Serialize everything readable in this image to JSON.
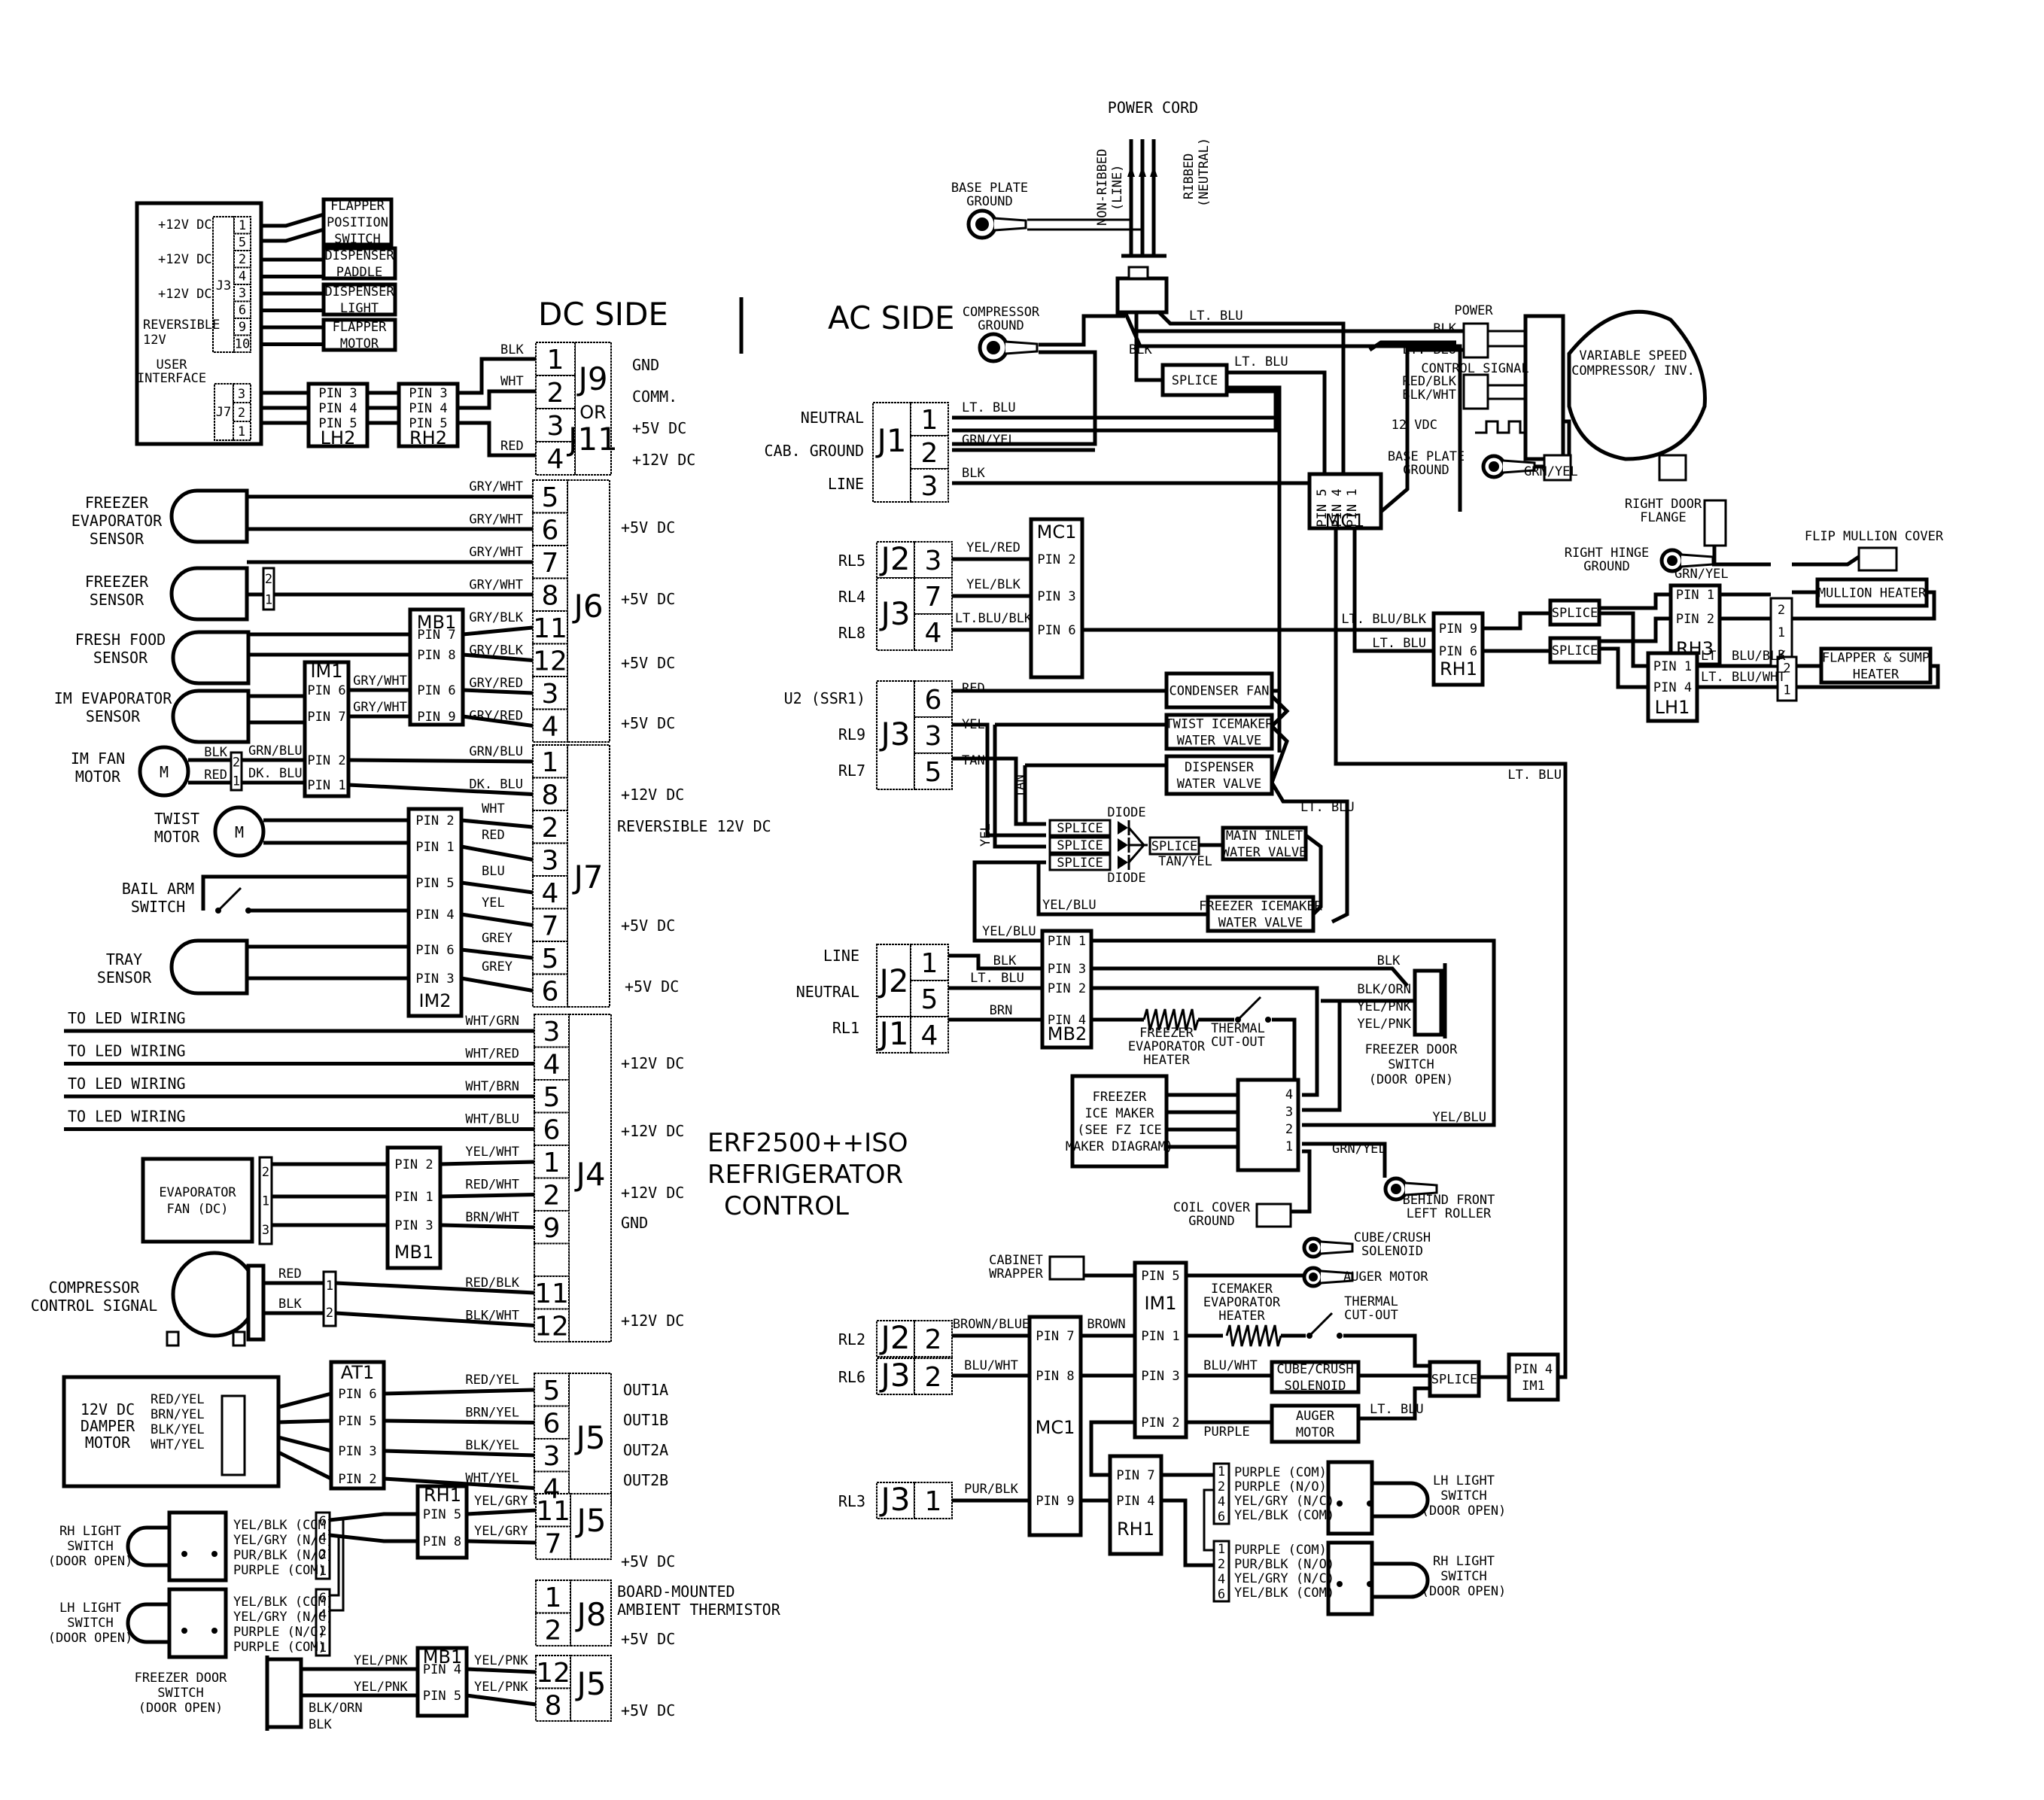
{
  "title": {
    "line1": "ERF2500++ISO",
    "line2": "REFRIGERATOR",
    "line3": "CONTROL"
  },
  "sections": {
    "dc": "DC SIDE",
    "ac": "AC SIDE"
  },
  "power_cord": {
    "title": "POWER CORD",
    "line": "NON-RIBBED",
    "line_sub": "(LINE)",
    "neutral": "RIBBED",
    "neutral_sub": "(NEUTRAL)"
  },
  "grounds": {
    "base_plate_top": [
      "BASE PLATE",
      "GROUND"
    ],
    "compressor": [
      "COMPRESSOR",
      "GROUND"
    ],
    "base_plate_right": [
      "BASE PLATE",
      "GROUND"
    ],
    "right_hinge": [
      "RIGHT HINGE",
      "GROUND"
    ],
    "right_door_flange": [
      "RIGHT DOOR",
      "FLANGE"
    ],
    "flip_mullion": "FLIP MULLION COVER",
    "coil_cover": [
      "COIL COVER",
      "GROUND"
    ],
    "behind_roller": [
      "BEHIND FRONT",
      "LEFT ROLLER"
    ],
    "cabinet_wrapper": [
      "CABINET",
      "WRAPPER"
    ]
  },
  "compressor_inv": {
    "label": [
      "VARIABLE SPEED",
      "COMPRESSOR/ INV."
    ],
    "power": "POWER",
    "control": "CONTROL SIGNAL",
    "vdc": "12 VDC"
  },
  "user_interface": {
    "label": [
      "USER",
      "INTERFACE"
    ],
    "j3": "J3",
    "j7": "J7",
    "j3_pins": [
      "1",
      "5",
      "2",
      "4",
      "3",
      "6",
      "9",
      "10"
    ],
    "j7_pins": [
      "3",
      "2",
      "1"
    ],
    "side_labels": [
      "+12V DC",
      "+12V DC",
      "+12V DC",
      "REVERSIBLE",
      "12V"
    ],
    "devices": [
      [
        "FLAPPER",
        "POSITION",
        "SWITCH"
      ],
      [
        "DISPENSER",
        "PADDLE"
      ],
      [
        "DISPENSER",
        "LIGHT"
      ],
      [
        "FLAPPER",
        "MOTOR"
      ]
    ],
    "lh2": {
      "name": "LH2",
      "pins": [
        "PIN 3",
        "PIN 4",
        "PIN 5"
      ]
    },
    "rh2": {
      "name": "RH2",
      "pins": [
        "PIN 3",
        "PIN 4",
        "PIN 5"
      ]
    }
  },
  "dc_connectors": {
    "j9": {
      "name": "J9",
      "or": "OR",
      "alt": "J11",
      "pins": [
        "1",
        "2",
        "3",
        "4"
      ],
      "wires": [
        "BLK",
        "WHT",
        "",
        "RED"
      ],
      "labels": [
        "GND",
        "COMM.",
        "+5V DC",
        "+12V DC"
      ]
    },
    "j6": {
      "name": "J6",
      "pins": [
        "5",
        "6",
        "7",
        "8",
        "11",
        "12",
        "3",
        "4"
      ],
      "wires": [
        "GRY/WHT",
        "GRY/WHT",
        "GRY/WHT",
        "GRY/WHT",
        "GRY/BLK",
        "GRY/BLK",
        "GRY/RED",
        "GRY/RED"
      ],
      "labels": [
        "+5V DC",
        "+5V DC",
        "+5V DC",
        "+5V DC"
      ]
    },
    "j7": {
      "name": "J7",
      "pins": [
        "1",
        "8",
        "2",
        "3",
        "4",
        "7",
        "5",
        "6"
      ],
      "wires": [
        "GRN/BLU",
        "DK. BLU",
        "WHT",
        "RED",
        "BLU",
        "YEL",
        "GREY",
        "GREY"
      ],
      "labels": [
        "+12V DC",
        "REVERSIBLE 12V DC",
        "+5V DC",
        "+5V DC"
      ]
    },
    "j4": {
      "name": "J4",
      "pins": [
        "3",
        "4",
        "5",
        "6",
        "1",
        "2",
        "9",
        "",
        "11",
        "12"
      ],
      "wires": [
        "WHT/GRN",
        "WHT/RED",
        "WHT/BRN",
        "WHT/BLU",
        "YEL/WHT",
        "RED/WHT",
        "BRN/WHT",
        "",
        "RED/BLK",
        "BLK/WHT"
      ],
      "labels": [
        "+12V DC",
        "+12V DC",
        "+12V DC",
        "GND",
        "+12V DC"
      ]
    },
    "j5a": {
      "name": "J5",
      "pins": [
        "5",
        "6",
        "3",
        "4"
      ],
      "wires": [
        "RED/YEL",
        "BRN/YEL",
        "BLK/YEL",
        "WHT/YEL"
      ],
      "labels": [
        "OUT1A",
        "OUT1B",
        "OUT2A",
        "OUT2B"
      ]
    },
    "j5b": {
      "name": "J5",
      "pins": [
        "11",
        "7"
      ],
      "wires": [
        "YEL/GRY",
        "YEL/GRY"
      ],
      "labels": [
        "+5V DC"
      ]
    },
    "j8": {
      "name": "J8",
      "pins": [
        "1",
        "2"
      ],
      "labels": [
        "BOARD-MOUNTED",
        "AMBIENT THERMISTOR",
        "+5V DC"
      ]
    },
    "j5c": {
      "name": "J5",
      "pins": [
        "12",
        "8"
      ],
      "wires": [
        "YEL/PNK",
        "YEL/PNK"
      ],
      "labels": [
        "+5V DC"
      ]
    }
  },
  "dc_devices": {
    "freezer_evap_sensor": [
      "FREEZER",
      "EVAPORATOR",
      "SENSOR"
    ],
    "freezer_sensor": [
      "FREEZER",
      "SENSOR"
    ],
    "fresh_food_sensor": [
      "FRESH FOOD",
      "SENSOR"
    ],
    "im_evap_sensor": [
      "IM EVAPORATOR",
      "SENSOR"
    ],
    "im_fan_motor": [
      "IM FAN",
      "MOTOR"
    ],
    "twist_motor": [
      "TWIST",
      "MOTOR"
    ],
    "bail_arm": [
      "BAIL ARM",
      "SWITCH"
    ],
    "tray_sensor": [
      "TRAY",
      "SENSOR"
    ],
    "led": "TO LED WIRING",
    "evap_fan": [
      "EVAPORATOR",
      "FAN (DC)"
    ],
    "comp_signal": [
      "COMPRESSOR",
      "CONTROL SIGNAL"
    ],
    "damper": [
      "12V DC",
      "DAMPER",
      "MOTOR"
    ],
    "damper_wires": [
      "RED/YEL",
      "BRN/YEL",
      "BLK/YEL",
      "WHT/YEL"
    ],
    "rh_light": [
      "RH LIGHT",
      "SWITCH",
      "(DOOR OPEN)"
    ],
    "lh_light": [
      "LH LIGHT",
      "SWITCH",
      "(DOOR OPEN)"
    ],
    "rh_light_wires": [
      "YEL/BLK (COM)",
      "YEL/GRY (N/C)",
      "PUR/BLK (N/O)",
      "PURPLE (COM)"
    ],
    "lh_light_wires": [
      "YEL/BLK (COM)",
      "YEL/GRY (N/C)",
      "PURPLE (N/O)",
      "PURPLE (COM)"
    ],
    "light_pins": [
      "6",
      "4",
      "2",
      "1"
    ],
    "fz_door": [
      "FREEZER DOOR",
      "SWITCH",
      "(DOOR OPEN)"
    ],
    "fz_door_wires": [
      "YEL/PNK",
      "YEL/PNK",
      "BLK/ORN",
      "BLK"
    ],
    "motor_glyph": "M"
  },
  "dc_harness": {
    "mb1_top": {
      "name": "MB1",
      "pins": [
        "PIN 7",
        "PIN 8",
        "PIN 6",
        "PIN 9"
      ]
    },
    "im1": {
      "name": "IM1",
      "pins": [
        "PIN 6",
        "PIN 7",
        "PIN 2",
        "PIN 1"
      ],
      "wires": [
        "GRY/WHT",
        "GRY/WHT",
        "GRN/BLU",
        "DK. BLU"
      ]
    },
    "fan_wires": [
      "BLK",
      "RED"
    ],
    "im2": {
      "name": "IM2",
      "pins": [
        "PIN 2",
        "PIN 1",
        "PIN 5",
        "PIN 4",
        "PIN 6",
        "PIN 3"
      ]
    },
    "mb1_mid": {
      "name": "MB1",
      "pins": [
        "PIN 2",
        "PIN 1",
        "PIN 3"
      ]
    },
    "comp_wires": [
      "RED",
      "BLK"
    ],
    "at1": {
      "name": "AT1",
      "pins": [
        "PIN 6",
        "PIN 5",
        "PIN 3",
        "PIN 2"
      ]
    },
    "rh1": {
      "name": "RH1",
      "pins": [
        "PIN 5",
        "PIN 8"
      ]
    },
    "mb1_bot": {
      "name": "MB1",
      "pins": [
        "PIN 4",
        "PIN 5"
      ]
    }
  },
  "ac_connectors": {
    "j1_top": {
      "name": "J1",
      "pins": [
        "1",
        "2",
        "3"
      ],
      "side": [
        "NEUTRAL",
        "CAB. GROUND",
        "LINE"
      ],
      "wires": [
        "LT. BLU",
        "GRN/YEL",
        "BLK"
      ]
    },
    "j2j3": {
      "names": [
        "J2",
        "J3"
      ],
      "pins": [
        "3",
        "7",
        "4"
      ],
      "side": [
        "RL5",
        "RL4",
        "RL8"
      ],
      "wires": [
        "YEL/RED",
        "YEL/BLK",
        "LT.BLU/BLK"
      ]
    },
    "j3_ssr": {
      "name": "J3",
      "pins": [
        "6",
        "3",
        "5"
      ],
      "side": [
        "U2 (SSR1)",
        "RL9",
        "RL7"
      ],
      "wires": [
        "RED",
        "YEL",
        "TAN"
      ]
    },
    "j2j1": {
      "names": [
        "J2",
        "J1"
      ],
      "pins": [
        "1",
        "5",
        "4"
      ],
      "side": [
        "LINE",
        "NEUTRAL",
        "RL1"
      ],
      "wires": [
        "BLK",
        "LT. BLU",
        "BRN"
      ]
    },
    "rl2": {
      "name": "J2",
      "pin": "2",
      "side": "RL2",
      "wire": "BROWN/BLUE"
    },
    "rl6": {
      "name": "J3",
      "pin": "2",
      "side": "RL6",
      "wire": "BLU/WHT"
    },
    "rl3": {
      "name": "J3",
      "pin": "1",
      "side": "RL3",
      "wire": "PUR/BLK"
    }
  },
  "ac_parts": {
    "mc1_top": {
      "name": "MC1",
      "pins": [
        "PIN 5",
        "PIN 4",
        "PIN 1"
      ]
    },
    "mc1_valve": {
      "name": "MC1",
      "pins": [
        "PIN 2",
        "PIN 3",
        "PIN 6"
      ]
    },
    "splice": "SPLICE",
    "diode": "DIODE",
    "condenser_fan": "CONDENSER FAN",
    "twist_valve": [
      "TWIST ICEMAKER",
      "WATER VALVE"
    ],
    "dispenser_valve": [
      "DISPENSER",
      "WATER VALVE"
    ],
    "main_inlet": [
      "MAIN INLET",
      "WATER VALVE"
    ],
    "fz_icemaker_valve": [
      "FREEZER ICEMAKER",
      "WATER VALVE"
    ],
    "valve_wires": {
      "tan": "TAN",
      "yel": "YEL",
      "tan_yel": "TAN/YEL",
      "yel_blu": "YEL/BLU",
      "lt_blu": "LT. BLU"
    },
    "rh1_heater": {
      "name": "RH1",
      "pins": [
        "PIN 9",
        "PIN 6"
      ],
      "wires": [
        "LT. BLU/BLK",
        "LT. BLU"
      ]
    },
    "rh3": {
      "name": "RH3",
      "pins": [
        "PIN 1",
        "PIN 2"
      ]
    },
    "lh1": {
      "name": "LH1",
      "pins": [
        "PIN 1",
        "PIN 4"
      ],
      "wires": [
        "LT. BLU/BLK",
        "LT. BLU/WHT"
      ]
    },
    "mullion_heater": "MULLION HEATER",
    "flapper_heater": [
      "FLAPPER & SUMP",
      "HEATER"
    ],
    "mullion_pins": [
      "2",
      "1",
      "3"
    ],
    "flapper_pins": [
      "2",
      "1"
    ],
    "grn_yel": "GRN/YEL",
    "lt_blu": "LT. BLU",
    "blk": "BLK",
    "red_blk": "RED/BLK",
    "blk_wht": "BLK/WHT",
    "mb2": {
      "name": "MB2",
      "pins": [
        "PIN 1",
        "PIN 3",
        "PIN 2",
        "PIN 4"
      ]
    },
    "yel_blu": "YEL/BLU",
    "fz_evap_heater": [
      "FREEZER",
      "EVAPORATOR",
      "HEATER"
    ],
    "thermal": [
      "THERMAL",
      "CUT-OUT"
    ],
    "fz_icemaker": [
      "FREEZER",
      "ICE MAKER",
      "(SEE FZ ICE",
      "MAKER DIAGRAM)"
    ],
    "im_pins": [
      "4",
      "3",
      "2",
      "1"
    ],
    "fz_door": [
      "FREEZER DOOR",
      "SWITCH",
      "(DOOR OPEN)"
    ],
    "fz_door_wires": [
      "BLK",
      "BLK/ORN",
      "YEL/PNK",
      "YEL/PNK"
    ],
    "cube_crush": [
      "CUBE/CRUSH",
      "SOLENOID"
    ],
    "auger": "AUGER MOTOR",
    "im1": {
      "name": "IM1",
      "pins": [
        "PIN 5",
        "PIN 1",
        "PIN 3",
        "PIN 2"
      ]
    },
    "mc1_bot": {
      "name": "MC1",
      "pins": [
        "PIN 7",
        "PIN 8",
        "PIN 9"
      ]
    },
    "brown": "BROWN",
    "im_heater": [
      "ICEMAKER",
      "EVAPORATOR",
      "HEATER"
    ],
    "blu_wht": "BLU/WHT",
    "purple": "PURPLE",
    "cube_box": [
      "CUBE/CRUSH",
      "SOLENOID"
    ],
    "auger_box": [
      "AUGER",
      "MOTOR"
    ],
    "im1_pin4": [
      "PIN 4",
      "IM1"
    ],
    "rh1_bot": {
      "name": "RH1",
      "pins": [
        "PIN 7",
        "PIN 4"
      ]
    },
    "lh_light": [
      "LH LIGHT",
      "SWITCH",
      "(DOOR OPEN)"
    ],
    "rh_light": [
      "RH LIGHT",
      "SWITCH",
      "(DOOR OPEN)"
    ],
    "lh_wires": [
      "PURPLE (COM)",
      "PURPLE (N/O)",
      "YEL/GRY (N/C)",
      "YEL/BLK (COM)"
    ],
    "rh_wires": [
      "PURPLE (COM)",
      "PUR/BLK (N/O)",
      "YEL/GRY (N/C)",
      "YEL/BLK (COM)"
    ],
    "light_pins": [
      "1",
      "2",
      "4",
      "6"
    ]
  }
}
